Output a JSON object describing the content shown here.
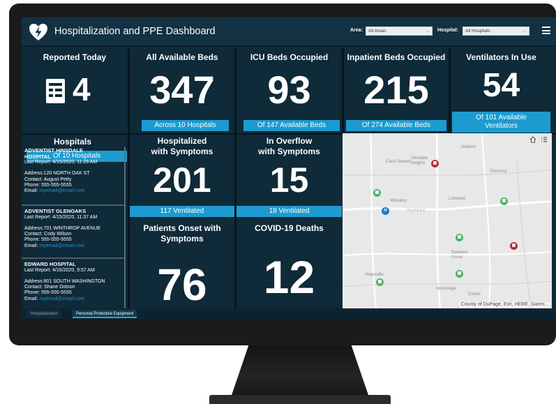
{
  "header": {
    "title": "Hospitalization and PPE Dashboard",
    "area_label": "Area:",
    "area_value": "All Areas",
    "hospital_label": "Hospital:",
    "hospital_value": "All Hospitals"
  },
  "kpis": [
    {
      "title": "Reported Today",
      "value": "4",
      "footer": "Of 10 Hospitals"
    },
    {
      "title": "All Available Beds",
      "value": "347",
      "footer": "Across 10 Hospitals"
    },
    {
      "title": "ICU Beds Occupied",
      "value": "93",
      "footer": "Of 147 Available Beds"
    },
    {
      "title": "Inpatient Beds Occupied",
      "value": "215",
      "footer": "Of 274 Available Beds"
    },
    {
      "title": "Ventilators In Use",
      "value": "54",
      "footer_line1": "Of 101 Available",
      "footer_line2": "Ventilators"
    }
  ],
  "hospitals_title": "Hospitals",
  "hospitals": [
    {
      "name_line1": "ADVENTIST HINSDALE",
      "name_line2": "HOSPITAL",
      "last_report": "Last Report: 4/15/2020, 11:28 AM",
      "address": "Address:120 NORTH OAK ST",
      "contact": "Contact: August Petty",
      "phone": "Phone: 555-555-5555",
      "email_label": "Email:",
      "email": "myemail@email.com"
    },
    {
      "name_line1": "ADVENTIST GLENOAKS",
      "last_report": "Last Report: 4/15/2020, 11:37 AM",
      "address": "Address:701 WINTHROP AVENUE",
      "contact": "Contact: Cody Wilson",
      "phone": "Phone: 555-555-5555",
      "email_label": "Email:",
      "email": "myemail@email.com"
    },
    {
      "name_line1": "EDWARD HOSPITAL",
      "last_report": "Last Report: 4/16/2020, 9:57 AM",
      "address": "Address:801 SOUTH WASHINGTON",
      "contact": "Contact: Shane Dotson",
      "phone": "Phone: 555-555-5555",
      "email_label": "Email:",
      "email": "myemail@email.com"
    }
  ],
  "mid_panels": {
    "hosp_title_line1": "Hospitalized",
    "hosp_title_line2": "with Symptoms",
    "hosp_value": "201",
    "hosp_footer": "117 Ventilated",
    "overflow_title_line1": "In Overflow",
    "overflow_title_line2": "with Symptoms",
    "overflow_value": "15",
    "overflow_footer": "18 Ventilated",
    "onset_title_line1": "Patients Onset with",
    "onset_title_line2": "Symptoms",
    "onset_value": "76",
    "deaths_title": "COVID-19 Deaths",
    "deaths_value": "12"
  },
  "map": {
    "credit": "County of DuPage, Esri, HERE, Garmi...",
    "places": [
      "Addison",
      "Carol Stream",
      "Glendale Heights",
      "Elmhurst",
      "Wheaton",
      "Lombard",
      "DUPAGE",
      "Downers Grove",
      "Naperville",
      "Woodridge",
      "Darien"
    ]
  },
  "tabs": [
    "Hospitalization",
    "Personal Protective Equipment"
  ],
  "colors": {
    "accent": "#1c9bd0",
    "panel": "#0f2a38",
    "header": "#123244",
    "pin_green": "#4fb36a",
    "pin_red": "#b22d33",
    "pin_blue": "#1e7bc7"
  }
}
